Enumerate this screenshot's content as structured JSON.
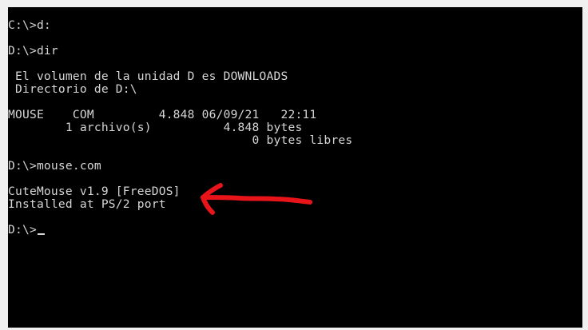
{
  "terminal": {
    "lines": [
      "C:\\>d:",
      "",
      "D:\\>dir",
      "",
      " El volumen de la unidad D es DOWNLOADS",
      " Directorio de D:\\",
      "",
      "MOUSE    COM         4.848 06/09/21   22:11",
      "        1 archivo(s)          4.848 bytes",
      "                                  0 bytes libres",
      "",
      "D:\\>mouse.com",
      "",
      "CuteMouse v1.9 [FreeDOS]",
      "Installed at PS/2 port",
      "",
      "D:\\>"
    ]
  },
  "annotation": {
    "arrow_color": "#e8141a",
    "icon": "hand-drawn-arrow-icon"
  },
  "colors": {
    "screen_background": "#000000",
    "text": "#d6d6d6",
    "frame": "#f0f0f0"
  }
}
